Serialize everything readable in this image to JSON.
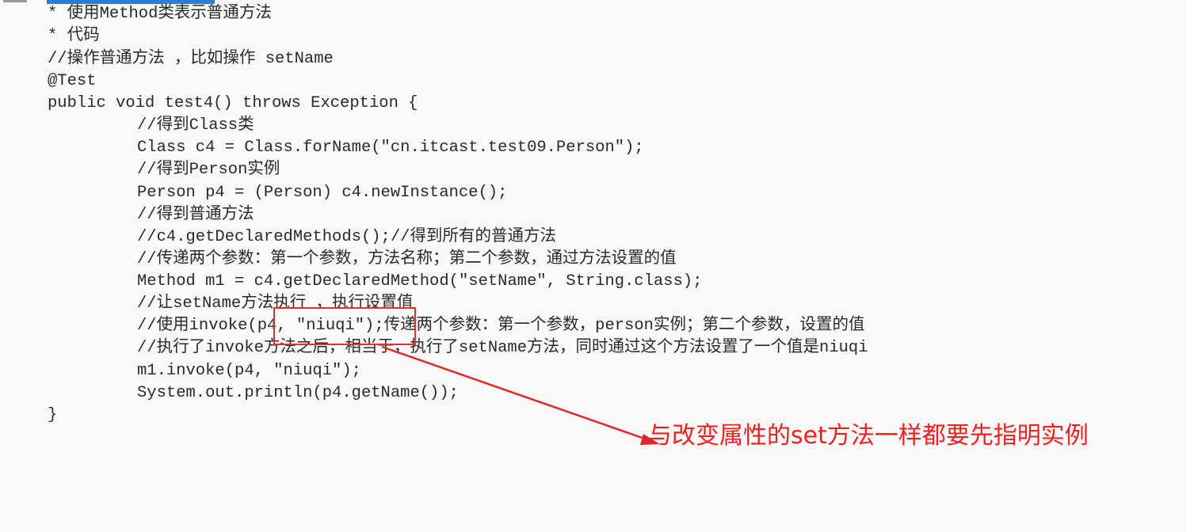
{
  "code": {
    "lines": [
      {
        "text": "* 使用Method类表示普通方法",
        "indent": 0
      },
      {
        "text": "* 代码",
        "indent": 0
      },
      {
        "text": "//操作普通方法 ，比如操作 setName",
        "indent": 0
      },
      {
        "text": "@Test",
        "indent": 0
      },
      {
        "text": "public void test4() throws Exception {",
        "indent": 0
      },
      {
        "text": "//得到Class类",
        "indent": 1
      },
      {
        "text": "Class c4 = Class.forName(\"cn.itcast.test09.Person\");",
        "indent": 1
      },
      {
        "text": "//得到Person实例",
        "indent": 1
      },
      {
        "text": "Person p4 = (Person) c4.newInstance();",
        "indent": 1
      },
      {
        "text": "//得到普通方法",
        "indent": 1
      },
      {
        "text": "//c4.getDeclaredMethods();//得到所有的普通方法",
        "indent": 1
      },
      {
        "text": "//传递两个参数：第一个参数，方法名称；第二个参数，通过方法设置的值",
        "indent": 1
      },
      {
        "text": "Method m1 = c4.getDeclaredMethod(\"setName\", String.class);",
        "indent": 1
      },
      {
        "text": "//让setName方法执行 ，执行设置值",
        "indent": 1
      },
      {
        "text": "//使用invoke(p4, \"niuqi\");传递两个参数：第一个参数，person实例；第二个参数，设置的值",
        "indent": 1
      },
      {
        "text": "//执行了invoke方法之后，相当于，执行了setName方法，同时通过这个方法设置了一个值是niuqi",
        "indent": 1
      },
      {
        "text": "m1.invoke(p4, \"niuqi\");",
        "indent": 1
      },
      {
        "text": "System.out.println(p4.getName());",
        "indent": 1
      },
      {
        "text": "}",
        "indent": 0
      }
    ]
  },
  "annotation": {
    "text": "与改变属性的set方法一样都要先指明实例",
    "color": "#f02020"
  },
  "colors": {
    "code_text": "#2a2a2a",
    "selection": "#2f7bd4",
    "highlight_box": "#e23030",
    "arrow": "#e02828",
    "background": "#f8f8f8"
  }
}
